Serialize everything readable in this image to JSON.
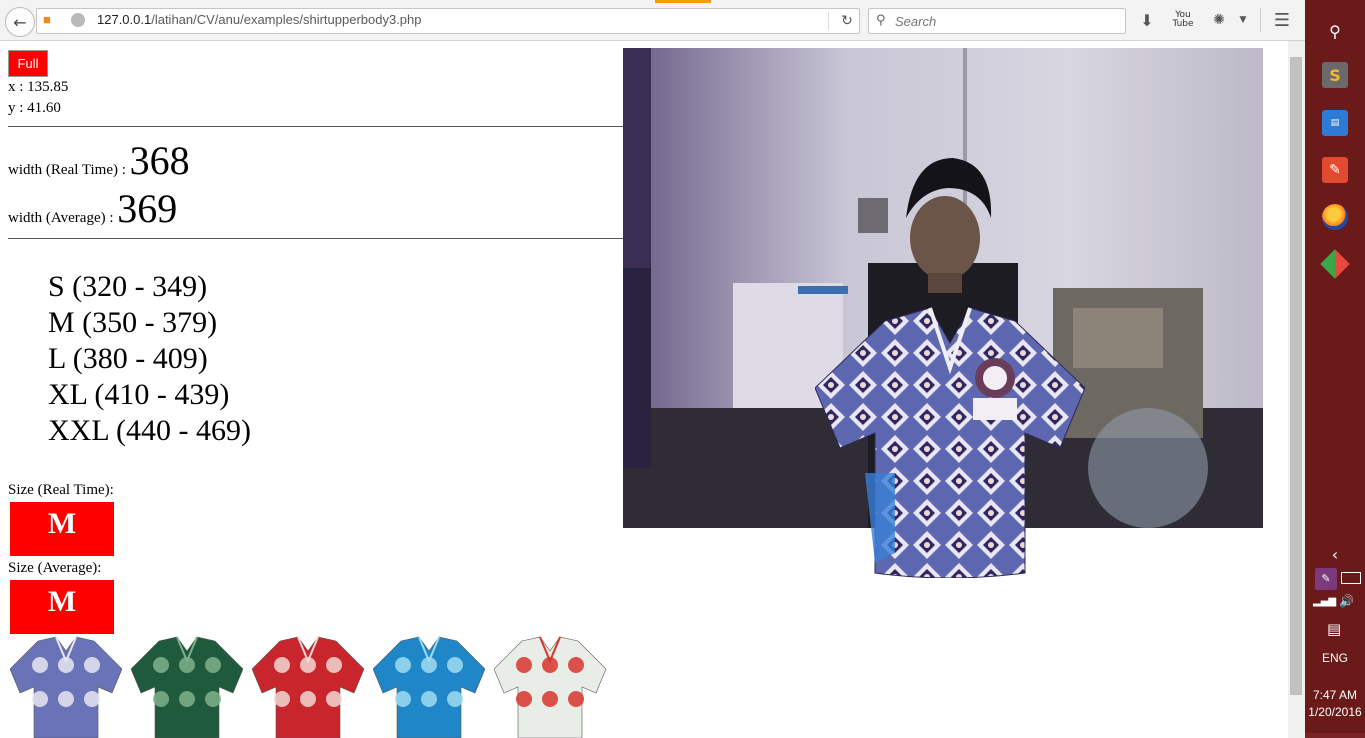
{
  "browser": {
    "url_host": "127.0.0.1",
    "url_path": "/latihan/CV/anu/examples/shirtupperbody3.php",
    "search_placeholder": "Search",
    "youtube_label": "You Tube"
  },
  "page": {
    "full_button": "Full",
    "coords": {
      "x": "x : 135.85",
      "y": "y : 41.60"
    },
    "width_realtime_label": "width (Real Time) : ",
    "width_realtime_value": "368",
    "width_average_label": "width (Average) : ",
    "width_average_value": "369",
    "size_ranges": [
      "S (320 - 349)",
      "M (350 - 379)",
      "L (380 - 409)",
      "XL (410 - 439)",
      "XXL (440 - 469)"
    ],
    "size_realtime_label": "Size (Real Time):",
    "size_realtime_value": "M",
    "size_average_label": "Size (Average):",
    "size_average_value": "M"
  },
  "shirts": [
    {
      "name": "batik-blue-white",
      "color": "#6a73b8",
      "accent": "#e8e6f2"
    },
    {
      "name": "batik-green",
      "color": "#1f5a3c",
      "accent": "#7fb08a"
    },
    {
      "name": "batik-red",
      "color": "#c8262c",
      "accent": "#f2d7d3"
    },
    {
      "name": "batik-cyan",
      "color": "#1f86c8",
      "accent": "#9fdcf0"
    },
    {
      "name": "batik-white-floral",
      "color": "#e9ede8",
      "accent": "#d8352d"
    }
  ],
  "taskbar": {
    "lang": "ENG",
    "time": "7:47 AM",
    "date": "1/20/2016"
  },
  "colors": {
    "size_box": "#ff0000",
    "taskbar": "#6b1a1a"
  }
}
